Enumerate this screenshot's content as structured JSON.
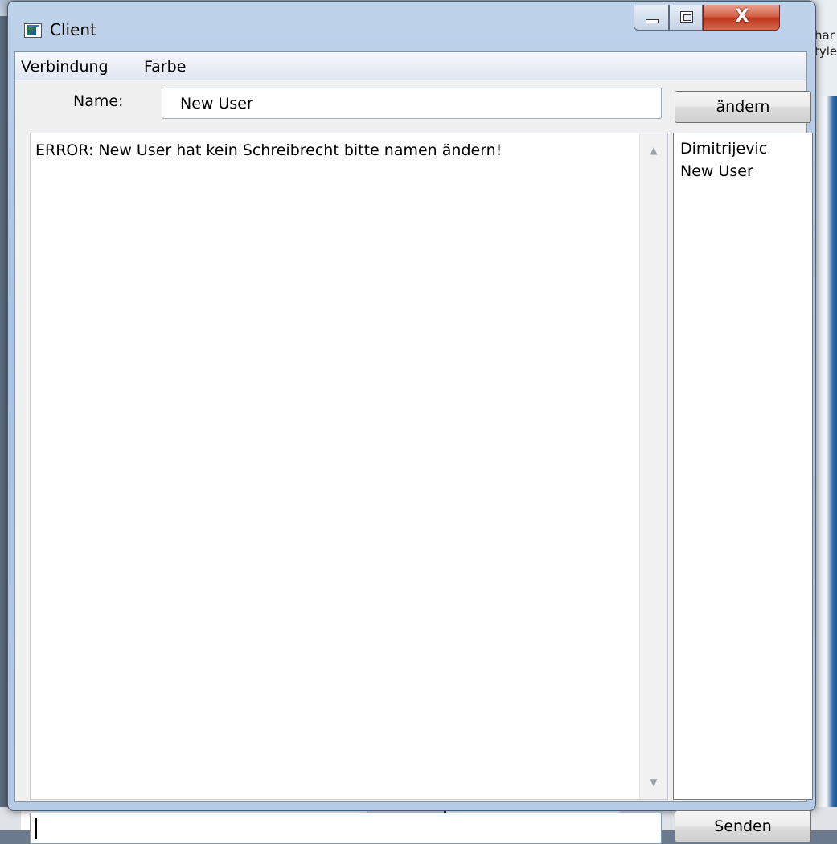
{
  "window": {
    "title": "Client",
    "controls": {
      "minimize_icon": "minimize-icon",
      "maximize_icon": "maximize-icon",
      "close_label": "X"
    }
  },
  "background": {
    "right_text_line1": "har",
    "right_text_line2": "tyle"
  },
  "menu": {
    "items": [
      {
        "label": "Verbindung"
      },
      {
        "label": "Farbe"
      }
    ]
  },
  "name_row": {
    "label": "Name:",
    "value": "New User",
    "button_label": "ändern"
  },
  "chat": {
    "messages": [
      "ERROR: New User hat kein Schreibrecht bitte namen ändern!"
    ]
  },
  "users": [
    "Dimitrijevic",
    "New User"
  ],
  "send_row": {
    "value": "",
    "button_label": "Senden"
  },
  "colors": {
    "close_button": "#c0381e",
    "titlebar": "#bfd3ea",
    "client_bg": "#f0f0f0"
  }
}
